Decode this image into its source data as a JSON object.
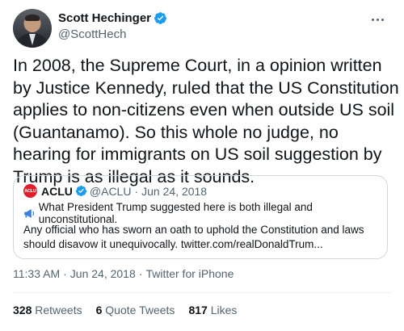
{
  "author": {
    "name": "Scott Hechinger",
    "handle": "@ScottHech",
    "verified_color": "#1d9bf0"
  },
  "tweet": {
    "text": "In 2008, the Supreme Court, in a opinion written by Justice Kennedy, ruled that the US Constitution applies to non-citizens even when outside US soil (Guantanamo). So this whole no judge, no hearing for immigrants on US soil suggestion by Trump is as illegal as it sounds.",
    "time": "11:33 AM",
    "date": "Jun 24, 2018",
    "source": "Twitter for iPhone",
    "separator": "·"
  },
  "quote": {
    "logo_text": "ACLU",
    "logo_color": "#e01f2d",
    "name": "ACLU",
    "handle": "@ACLU",
    "separator": "·",
    "date": "Jun 24, 2018",
    "icon": "megaphone-icon",
    "line1": "What President Trump suggested here is both illegal and unconstitutional.",
    "line2": "Any official who has sworn an oath to uphold the Constitution and laws should disavow it unequivocally. twitter.com/realDonaldTrum..."
  },
  "stats": {
    "retweets_count": "328",
    "retweets_label": "Retweets",
    "quotes_count": "6",
    "quotes_label": "Quote Tweets",
    "likes_count": "817",
    "likes_label": "Likes"
  }
}
